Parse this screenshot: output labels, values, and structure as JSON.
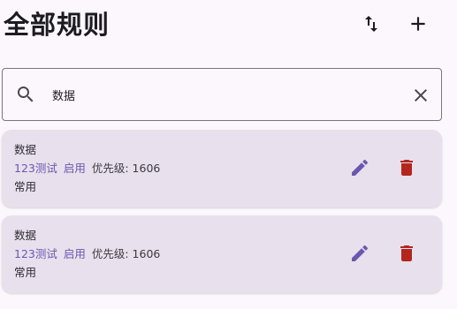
{
  "header": {
    "title": "全部规则",
    "sort_icon": "swap-vert-icon",
    "add_icon": "add-icon"
  },
  "search": {
    "value": "数据",
    "icon": "search-icon",
    "clear_icon": "close-icon"
  },
  "rules": [
    {
      "name": "数据",
      "group": "123测试",
      "status": "启用",
      "priority": "优先级: 1606",
      "category": "常用"
    },
    {
      "name": "数据",
      "group": "123测试",
      "status": "启用",
      "priority": "优先级: 1606",
      "category": "常用"
    }
  ],
  "colors": {
    "accent": "#6b57b0",
    "delete": "#b3261e",
    "card_bg": "#e8e0ec",
    "page_bg": "#fcf7fd"
  }
}
